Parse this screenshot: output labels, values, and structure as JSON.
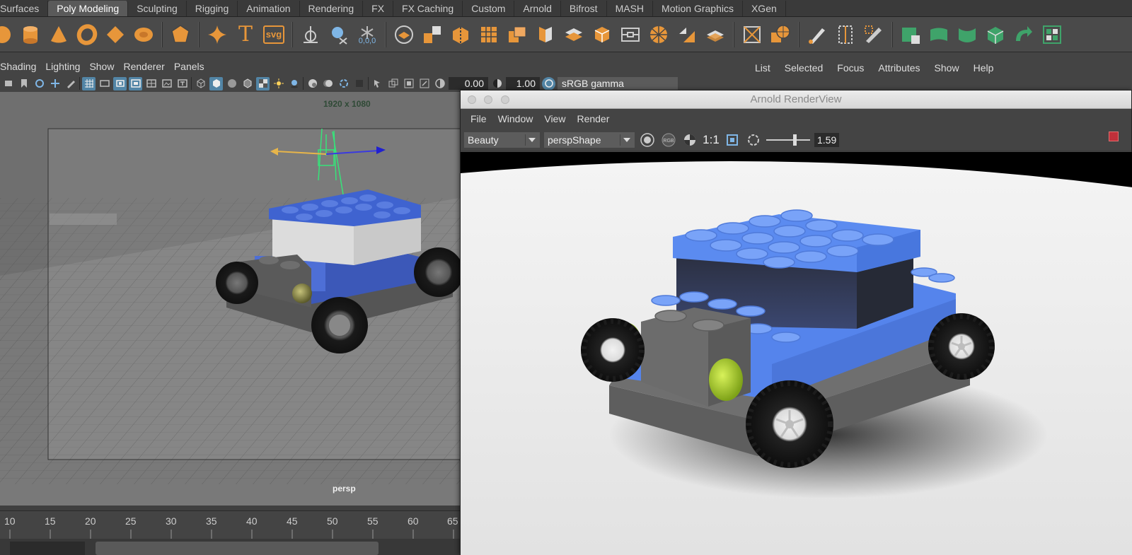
{
  "shelf_tabs": [
    {
      "label": "Surfaces",
      "active": false
    },
    {
      "label": "Poly Modeling",
      "active": true
    },
    {
      "label": "Sculpting",
      "active": false
    },
    {
      "label": "Rigging",
      "active": false
    },
    {
      "label": "Animation",
      "active": false
    },
    {
      "label": "Rendering",
      "active": false
    },
    {
      "label": "FX",
      "active": false
    },
    {
      "label": "FX Caching",
      "active": false
    },
    {
      "label": "Custom",
      "active": false
    },
    {
      "label": "Arnold",
      "active": false
    },
    {
      "label": "Bifrost",
      "active": false
    },
    {
      "label": "MASH",
      "active": false
    },
    {
      "label": "Motion Graphics",
      "active": false
    },
    {
      "label": "XGen",
      "active": false
    }
  ],
  "shelf_text": {
    "type_tool": "T",
    "svg_tool": "svg",
    "origin_label": "0,0,0"
  },
  "viewport_panel": {
    "menu": [
      "Shading",
      "Lighting",
      "Show",
      "Renderer",
      "Panels"
    ],
    "exposure_value": "0.00",
    "gamma_value": "1.00",
    "color_space": "sRGB gamma",
    "resolution_gate": "1920 x 1080",
    "camera_name": "persp"
  },
  "right_panel_menu": [
    "List",
    "Selected",
    "Focus",
    "Attributes",
    "Show",
    "Help"
  ],
  "timeline": {
    "ticks": [
      "10",
      "15",
      "20",
      "25",
      "30",
      "35",
      "40",
      "45",
      "50",
      "55",
      "60",
      "65"
    ]
  },
  "render_view": {
    "title": "Arnold RenderView",
    "menu": [
      "File",
      "Window",
      "View",
      "Render"
    ],
    "aov": "Beauty",
    "camera": "perspShape",
    "zoom_ratio": "1:1",
    "exposure_value": "1.59",
    "rgb_icon_label": "RGB"
  },
  "colors": {
    "accent_orange": "#e7963a",
    "brick_blue": "#4f7ce0",
    "render_floor": "#efefef",
    "viewport_bg": "#7f7f7f",
    "selected_blue": "#5285a6"
  }
}
